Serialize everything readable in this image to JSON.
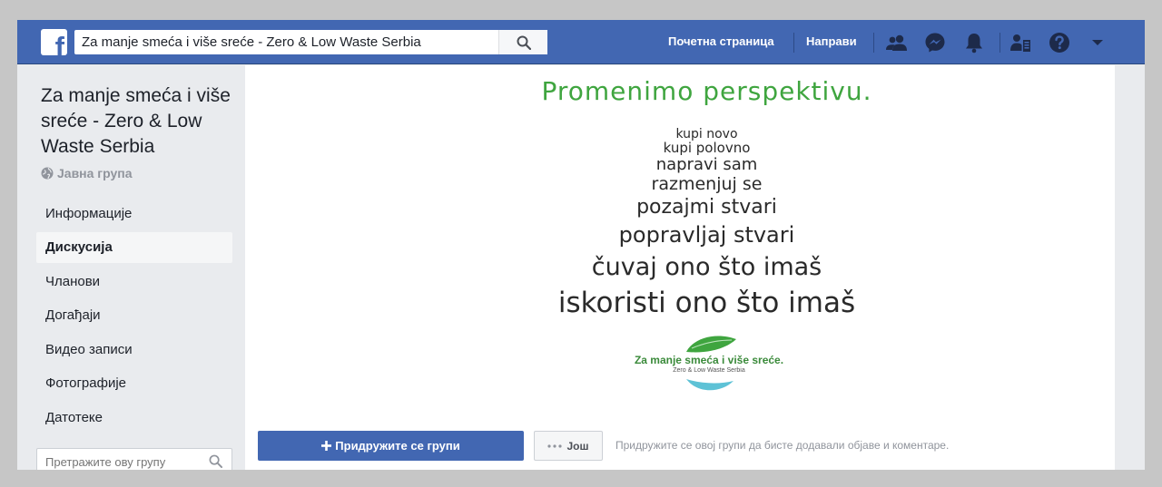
{
  "header": {
    "logo_letter": "f",
    "search_value": "Za manje smeća i više sreće - Zero & Low Waste Serbia",
    "nav": [
      "Почетна страница",
      "Направи"
    ],
    "icons": [
      "friends-icon",
      "messenger-icon",
      "notifications-icon",
      "friend-requests-icon",
      "help-icon",
      "dropdown-arrow-icon"
    ],
    "bar_color": "#4267b2"
  },
  "sidebar": {
    "group_title": "Za manje smeća i više sreće - Zero & Low Waste Serbia",
    "privacy": "Јавна група",
    "items": [
      {
        "label": "Информације",
        "active": false
      },
      {
        "label": "Дискусија",
        "active": true
      },
      {
        "label": "Чланови",
        "active": false
      },
      {
        "label": "Догађаји",
        "active": false
      },
      {
        "label": "Видео записи",
        "active": false
      },
      {
        "label": "Фотографије",
        "active": false
      },
      {
        "label": "Датотеке",
        "active": false
      }
    ],
    "search_placeholder": "Претражите ову групу"
  },
  "cover": {
    "headline": "Promenimo perspektivu.",
    "lines": [
      "kupi novo",
      "kupi polovno",
      "napravi sam",
      "razmenjuj se",
      "pozajmi stvari",
      "popravljaj stvari",
      "čuvaj ono što imaš",
      "iskoristi ono što imaš"
    ],
    "logo_text": "Za manje smeća i više sreće.",
    "logo_subtext": "Zero & Low Waste Serbia",
    "headline_color": "#3fa53f"
  },
  "actions": {
    "join_label": "Придружите се групи",
    "more_label": "Још",
    "join_note": "Придружите се овој групи да бисте додавали објаве и коментаре."
  }
}
